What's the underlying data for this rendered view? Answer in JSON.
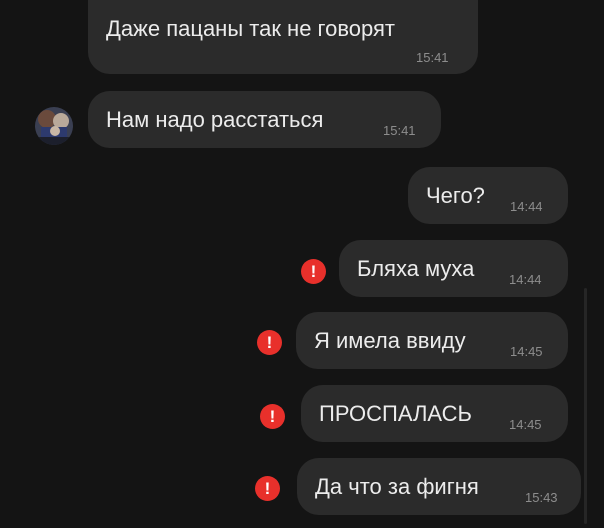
{
  "messages": [
    {
      "text": "Даже пацаны так не говорят",
      "time": "15:41",
      "direction": "incoming",
      "status": "ok"
    },
    {
      "text": "Нам надо расстаться",
      "time": "15:41",
      "direction": "incoming",
      "status": "ok"
    },
    {
      "text": "Чего?",
      "time": "14:44",
      "direction": "outgoing",
      "status": "sent"
    },
    {
      "text": "Бляха муха",
      "time": "14:44",
      "direction": "outgoing",
      "status": "failed"
    },
    {
      "text": "Я имела ввиду",
      "time": "14:45",
      "direction": "outgoing",
      "status": "failed"
    },
    {
      "text": "ПРОСПАЛАСЬ",
      "time": "14:45",
      "direction": "outgoing",
      "status": "failed"
    },
    {
      "text": "Да что за фигня",
      "time": "15:43",
      "direction": "outgoing",
      "status": "failed"
    }
  ],
  "error_icon_glyph": "!",
  "icons": {
    "error": "error-icon",
    "avatar": "contact-avatar"
  },
  "colors": {
    "background": "#141414",
    "bubble": "#2b2b2b",
    "text": "#ececec",
    "time": "#8d8d8d",
    "error": "#e8302b"
  }
}
